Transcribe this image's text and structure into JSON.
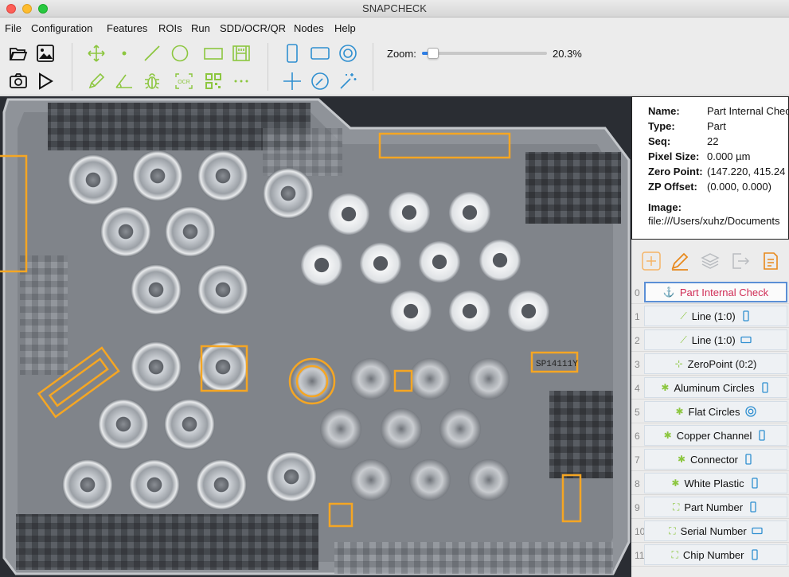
{
  "window": {
    "title": "SNAPCHECK"
  },
  "menu": [
    "File",
    "Configuration",
    "Features",
    "ROIs",
    "Run",
    "SDD/OCR/QR",
    "Nodes",
    "Help"
  ],
  "toolbar": {
    "zoom_label": "Zoom:",
    "zoom_value": "20.3%",
    "zoom_fraction": 0.06,
    "icons": [
      "open-folder-icon",
      "image-icon",
      "camera-icon",
      "play-icon",
      "move-icon",
      "point-icon",
      "line-icon",
      "circle-icon",
      "rectangle-icon",
      "caliper-icon",
      "pen-icon",
      "angle-icon",
      "bug-icon",
      "ocr-icon",
      "qr-code-icon",
      "more-icon",
      "vertical-rect-icon",
      "horizontal-rect-icon",
      "concentric-circle-icon",
      "crosshair-icon",
      "magnify-icon",
      "magic-wand-icon"
    ]
  },
  "info": {
    "name_label": "Name:",
    "name_value": "Part Internal Check",
    "type_label": "Type:",
    "type_value": "Part",
    "seq_label": "Seq:",
    "seq_value": "22",
    "pixel_label": "Pixel Size:",
    "pixel_value": "0.000 µm",
    "zero_label": "Zero Point:",
    "zero_value": "(147.220, 415.24",
    "zp_label": "ZP Offset:",
    "zp_value": "(0.000, 0.000)",
    "image_label": "Image:",
    "image_value": "file:///Users/xuhz/Documents"
  },
  "actions": [
    "add-icon",
    "edit-icon",
    "layers-icon",
    "export-icon",
    "report-icon"
  ],
  "colors": {
    "accent": "#f5a623",
    "selected_text": "#d02c55",
    "green_icon": "#8cc63f",
    "blue_icon": "#2f8fd0"
  },
  "rois": [
    {
      "index": "0",
      "label": "Part Internal Check",
      "icon": "part-icon",
      "shape": ""
    },
    {
      "index": "1",
      "label": "Line (1:0)",
      "icon": "line-icon",
      "shape": "vertical-rect"
    },
    {
      "index": "2",
      "label": "Line (1:0)",
      "icon": "line-icon",
      "shape": "horizontal-rect"
    },
    {
      "index": "3",
      "label": "ZeroPoint (0:2)",
      "icon": "zeropoint-icon",
      "shape": ""
    },
    {
      "index": "4",
      "label": "Aluminum Circles",
      "icon": "bug-icon",
      "shape": "vertical-rect"
    },
    {
      "index": "5",
      "label": "Flat Circles",
      "icon": "bug-icon",
      "shape": "concentric-circle"
    },
    {
      "index": "6",
      "label": "Copper Channel",
      "icon": "bug-icon",
      "shape": "vertical-rect"
    },
    {
      "index": "7",
      "label": "Connector",
      "icon": "bug-icon",
      "shape": "vertical-rect"
    },
    {
      "index": "8",
      "label": "White Plastic",
      "icon": "bug-icon",
      "shape": "vertical-rect"
    },
    {
      "index": "9",
      "label": "Part Number",
      "icon": "ocr-icon",
      "shape": "vertical-rect"
    },
    {
      "index": "10",
      "label": "Serial Number",
      "icon": "ocr-icon",
      "shape": "horizontal-rect"
    },
    {
      "index": "11",
      "label": "Chip Number",
      "icon": "ocr-icon",
      "shape": "vertical-rect"
    }
  ],
  "canvas_labels": {
    "serial_text": "SP14111Y"
  }
}
